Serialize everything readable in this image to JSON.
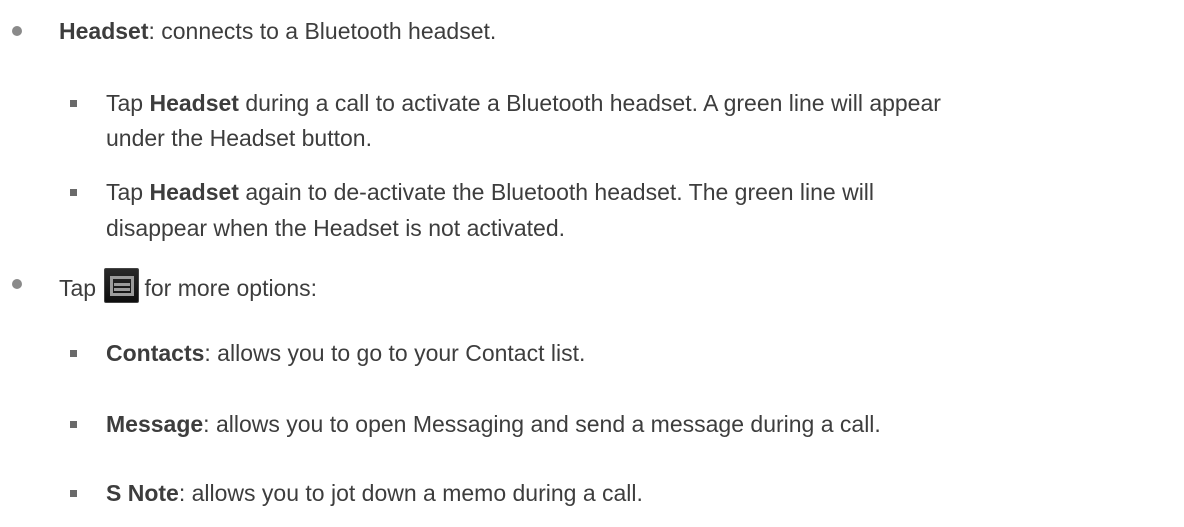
{
  "items": [
    {
      "term": "Headset",
      "text": ": connects to a Bluetooth headset.",
      "sub": [
        {
          "line1_pre": "Tap ",
          "line1_bold": "Headset",
          "line1_post": " during a call to activate a Bluetooth headset. A green line will appear",
          "line2": "under the Headset button."
        },
        {
          "line1_pre": "Tap ",
          "line1_bold": "Headset",
          "line1_post": " again to de-activate the Bluetooth headset. The green line will",
          "line2": "disappear when the Headset is not activated."
        }
      ]
    },
    {
      "pre": "Tap",
      "icon": "menu-icon",
      "post": "for more options:",
      "sub": [
        {
          "term": "Contacts",
          "text": ": allows you to go to your Contact list."
        },
        {
          "term": "Message",
          "text": ": allows you to open Messaging and send a message during a call."
        },
        {
          "term": "S Note",
          "text": ": allows you to jot down a memo during a call."
        }
      ]
    }
  ]
}
